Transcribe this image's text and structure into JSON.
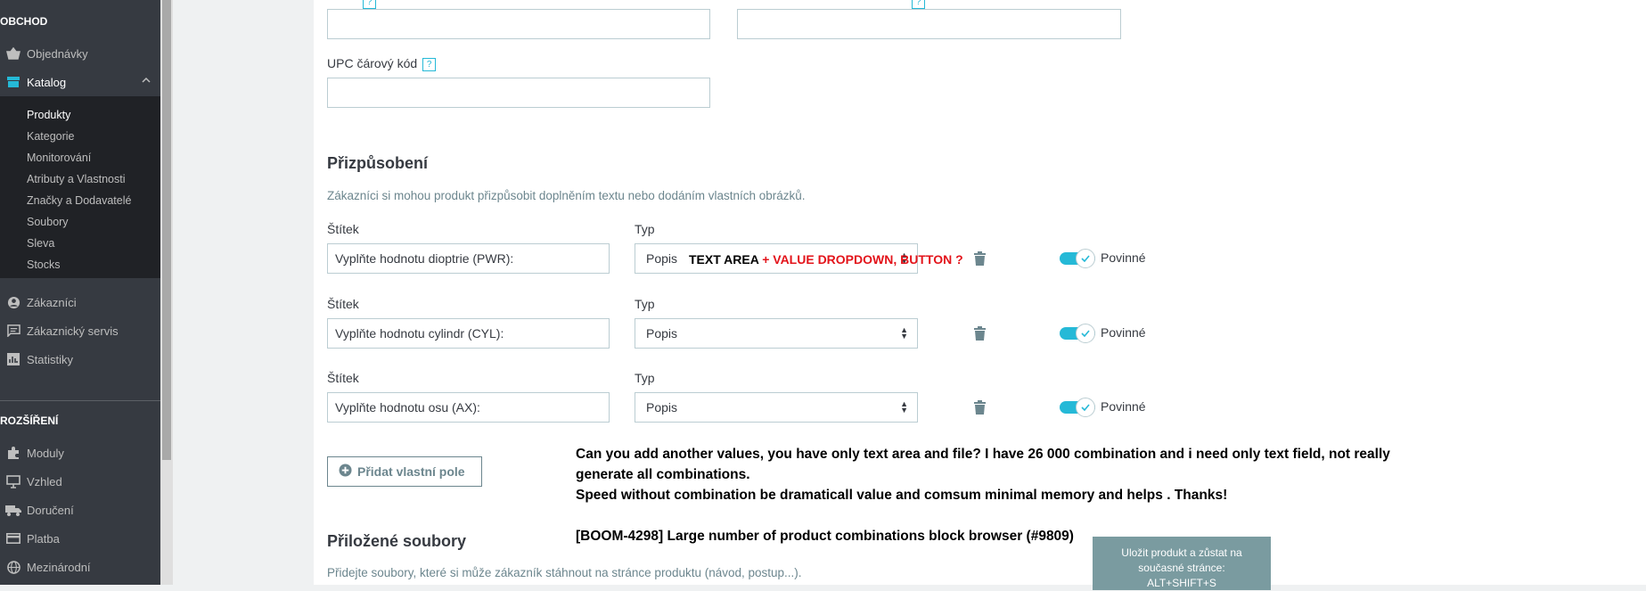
{
  "sidebar": {
    "section_shop": "OBCHOD",
    "items_top": [
      {
        "label": "Objednávky",
        "icon": "basket-icon"
      },
      {
        "label": "Katalog",
        "icon": "store-icon"
      }
    ],
    "catalog_sub": [
      "Produkty",
      "Kategorie",
      "Monitorování",
      "Atributy a Vlastnosti",
      "Značky a Dodavatelé",
      "Soubory",
      "Sleva",
      "Stocks"
    ],
    "items_mid": [
      {
        "label": "Zákazníci",
        "icon": "user-icon"
      },
      {
        "label": "Zákaznický servis",
        "icon": "chat-icon"
      },
      {
        "label": "Statistiky",
        "icon": "chart-icon"
      }
    ],
    "section_ext": "ROZŠÍŘENÍ",
    "items_ext": [
      {
        "label": "Moduly",
        "icon": "puzzle-icon"
      },
      {
        "label": "Vzhled",
        "icon": "monitor-icon"
      },
      {
        "label": "Doručení",
        "icon": "truck-icon"
      },
      {
        "label": "Platba",
        "icon": "card-icon"
      },
      {
        "label": "Mezinárodní",
        "icon": "globe-icon"
      }
    ]
  },
  "form": {
    "upc_label": "UPC čárový kód",
    "help_glyph": "?",
    "customization_title": "Přizpůsobení",
    "customization_desc": "Zákazníci si mohou produkt přizpůsobit doplněním textu nebo dodáním vlastních obrázků.",
    "rows": [
      {
        "label_title": "Štítek",
        "type_title": "Typ",
        "label_value": "Vyplňte hodnotu dioptrie (PWR):",
        "type_value": "Popis",
        "required": "Povinné"
      },
      {
        "label_title": "Štítek",
        "type_title": "Typ",
        "label_value": "Vyplňte hodnotu cylindr (CYL):",
        "type_value": "Popis",
        "required": "Povinné"
      },
      {
        "label_title": "Štítek",
        "type_title": "Typ",
        "label_value": "Vyplňte hodnotu osu (AX):",
        "type_value": "Popis",
        "required": "Povinné"
      }
    ],
    "add_field_button": "Přidat vlastní pole",
    "attached_title": "Přiložené soubory",
    "attached_desc": "Přidejte soubory, které si může zákazník stáhnout na stránce produktu (návod, postup...)."
  },
  "annotation": {
    "inline_black": "TEXT AREA",
    "inline_red": "+ VALUE DROPDOWN, BUTTON ?",
    "line1": "Can you add another values, you have only text area and file? I have 26 000 combination and i need only text field, not really",
    "line2": "generate all combinations.",
    "line3": "Speed without combination be dramaticall value and comsum minimal memory and helps . Thanks!",
    "line4": "[BOOM-4298] Large number of product combinations block browser (#9809)"
  },
  "save_tooltip": {
    "line1": "Uložit produkt a zůstat na",
    "line2": "současné stránce:",
    "line3": "ALT+SHIFT+S"
  },
  "colors": {
    "accent": "#25b9d7",
    "sidebar": "#363a41",
    "annotation_red": "#e3141b"
  }
}
